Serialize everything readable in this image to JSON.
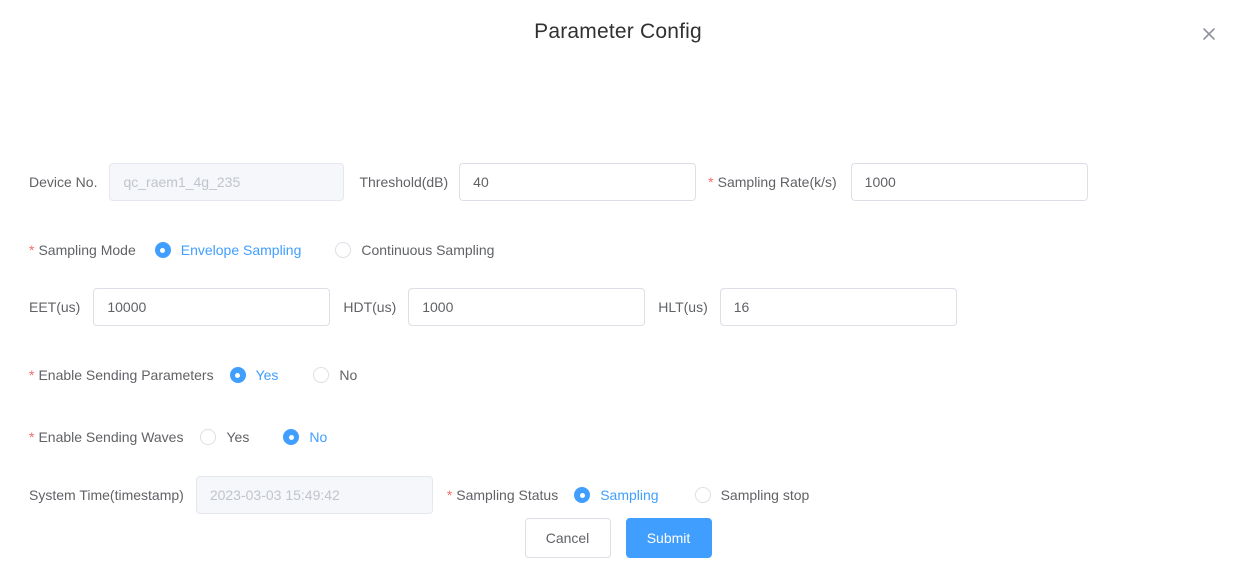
{
  "dialog": {
    "title": "Parameter Config",
    "close_icon": "close-icon"
  },
  "fields": {
    "device_no": {
      "label": "Device No.",
      "value": "",
      "placeholder": "qc_raem1_4g_235",
      "disabled": true,
      "required": false
    },
    "threshold": {
      "label": "Threshold(dB)",
      "value": "40",
      "placeholder": "",
      "disabled": false,
      "required": false
    },
    "sampling_rate": {
      "label": "Sampling Rate(k/s)",
      "value": "1000",
      "placeholder": "",
      "disabled": false,
      "required": true
    },
    "eet": {
      "label": "EET(us)",
      "value": "10000",
      "placeholder": "",
      "disabled": false,
      "required": false
    },
    "hdt": {
      "label": "HDT(us)",
      "value": "1000",
      "placeholder": "",
      "disabled": false,
      "required": false
    },
    "hlt": {
      "label": "HLT(us)",
      "value": "16",
      "placeholder": "",
      "disabled": false,
      "required": false
    },
    "system_time": {
      "label": "System Time(timestamp)",
      "value": "",
      "placeholder": "2023-03-03 15:49:42",
      "disabled": true,
      "required": false
    }
  },
  "radio_groups": {
    "sampling_mode": {
      "label": "Sampling Mode",
      "required": true,
      "options": [
        {
          "label": "Envelope Sampling",
          "selected": true
        },
        {
          "label": "Continuous Sampling",
          "selected": false
        }
      ]
    },
    "enable_sending_parameters": {
      "label": "Enable Sending Parameters",
      "required": true,
      "options": [
        {
          "label": "Yes",
          "selected": true
        },
        {
          "label": "No",
          "selected": false
        }
      ]
    },
    "enable_sending_waves": {
      "label": "Enable Sending Waves",
      "required": true,
      "options": [
        {
          "label": "Yes",
          "selected": false
        },
        {
          "label": "No",
          "selected": true
        }
      ]
    },
    "sampling_status": {
      "label": "Sampling Status",
      "required": true,
      "options": [
        {
          "label": "Sampling",
          "selected": true
        },
        {
          "label": "Sampling stop",
          "selected": false
        }
      ]
    }
  },
  "footer": {
    "cancel_label": "Cancel",
    "submit_label": "Submit"
  },
  "colors": {
    "accent": "#409eff",
    "required_asterisk": "#f56c6c",
    "text": "#606266",
    "title_text": "#303133",
    "border": "#dcdfe6",
    "disabled_bg": "#f5f7fa",
    "placeholder": "#c0c4cc"
  }
}
